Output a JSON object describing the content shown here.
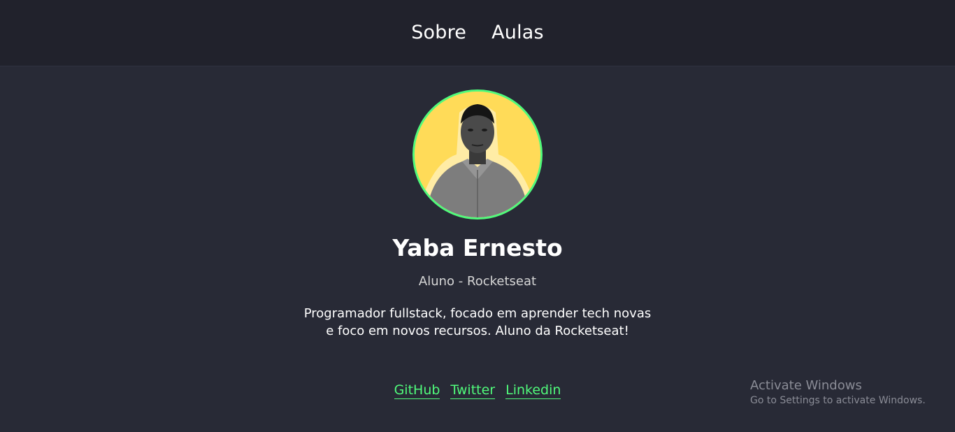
{
  "nav": {
    "items": [
      {
        "label": "Sobre"
      },
      {
        "label": "Aulas"
      }
    ]
  },
  "profile": {
    "name": "Yaba Ernesto",
    "role": "Aluno - Rocketseat",
    "bio": "Programador fullstack, focado em aprender tech novas e foco em novos recursos. Aluno da Rocketseat!"
  },
  "links": [
    {
      "label": "GitHub"
    },
    {
      "label": "Twitter"
    },
    {
      "label": "Linkedin"
    }
  ],
  "watermark": {
    "title": "Activate Windows",
    "subtitle": "Go to Settings to activate Windows."
  },
  "colors": {
    "background": "#282a36",
    "header": "#21222c",
    "accent": "#50fa7b",
    "avatar_bg": "#ffdb58"
  }
}
